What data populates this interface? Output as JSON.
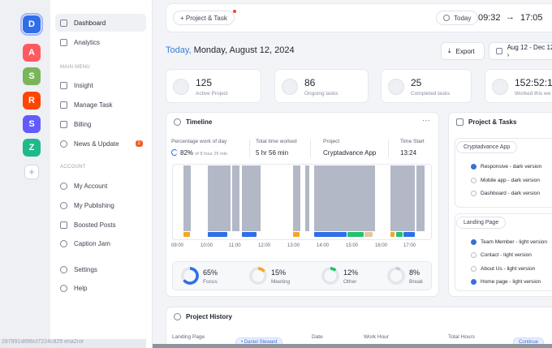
{
  "rail": {
    "apps": [
      {
        "icon": "app-logo-icon",
        "letter": "D",
        "color": "#2f6ee8"
      },
      {
        "icon": "airbnb-icon",
        "letter": "A",
        "color": "#ff5a5f"
      },
      {
        "icon": "shopify-icon",
        "letter": "S",
        "color": "#7ab55c"
      },
      {
        "icon": "reddit-icon",
        "letter": "R",
        "color": "#ff4500"
      },
      {
        "icon": "stripe-icon",
        "letter": "S",
        "color": "#635bff"
      },
      {
        "icon": "app-icon",
        "letter": "Z",
        "color": "#1fb98a"
      }
    ],
    "add_label": "+"
  },
  "sidebar": {
    "primary": [
      {
        "label": "Dashboard",
        "icon": "grid-icon",
        "active": true
      },
      {
        "label": "Analytics",
        "icon": "chart-icon"
      }
    ],
    "main_menu_title": "MAIN MENU",
    "main_menu": [
      {
        "label": "Insight",
        "icon": "trend-icon"
      },
      {
        "label": "Manage Task",
        "icon": "file-icon"
      },
      {
        "label": "Billing",
        "icon": "card-icon"
      },
      {
        "label": "News & Update",
        "icon": "clip-icon",
        "badge": "2"
      }
    ],
    "account_title": "ACCOUNT",
    "account": [
      {
        "label": "My Account",
        "icon": "user-icon"
      },
      {
        "label": "My Publishing",
        "icon": "users-icon"
      },
      {
        "label": "Boosted Posts",
        "icon": "megaphone-icon"
      },
      {
        "label": "Caption Jam",
        "icon": "history-icon"
      }
    ],
    "footer": [
      {
        "label": "Settings",
        "icon": "gear-icon"
      },
      {
        "label": "Help",
        "icon": "help-icon"
      }
    ]
  },
  "topbar": {
    "add_label": "+ Project & Task",
    "today_label": "Today",
    "time_start": "09:32",
    "arrow": "→",
    "time_end": "17:05"
  },
  "header": {
    "today": "Today,",
    "date": "Monday, August 12, 2024",
    "export_label": "Export",
    "range_label": "Aug 12 - Dec 12 ›"
  },
  "stats": [
    {
      "value": "125",
      "label": "Active Project"
    },
    {
      "value": "86",
      "label": "Ongoing tasks"
    },
    {
      "value": "25",
      "label": "Completed tasks"
    },
    {
      "value": "152:52:1",
      "label": "Worked this we"
    }
  ],
  "timeline": {
    "title": "Timeline",
    "more": "···",
    "metrics": {
      "work_label": "Percentage work of day",
      "work_value": "82%",
      "work_sub": "of 8 hour 25 min",
      "total_label": "Total time worked",
      "total_value": "5 hr 56 min",
      "project_label": "Project",
      "project_value": "Cryptadvance App",
      "start_label": "Time Start",
      "start_value": "13:24"
    },
    "ticks": [
      "09:00",
      "10:00",
      "11:00",
      "12:00",
      "13:00",
      "14:00",
      "15:00",
      "16:00",
      "17:00",
      "18:00"
    ],
    "summary": [
      {
        "pct": "65%",
        "label": "Focus",
        "color": "#2f6ee8",
        "value": 0.65
      },
      {
        "pct": "15%",
        "label": "Meeting",
        "color": "#f5a623",
        "value": 0.15
      },
      {
        "pct": "12%",
        "label": "Other",
        "color": "#21c26b",
        "value": 0.12
      },
      {
        "pct": "8%",
        "label": "Break",
        "color": "#c5c9d2",
        "value": 0.08
      }
    ]
  },
  "projects": {
    "title": "Project & Tasks",
    "groups": [
      {
        "name": "Cryptadvance App",
        "items": [
          {
            "label": "Responsive - dark version",
            "done": true
          },
          {
            "label": "Mobile app - dark version",
            "done": false
          },
          {
            "label": "Dashboard - dark version",
            "done": false
          }
        ]
      },
      {
        "name": "Landing Page",
        "items": [
          {
            "label": "Team Member - light version",
            "done": true
          },
          {
            "label": "Contact - light version",
            "done": false
          },
          {
            "label": "About Us - light version",
            "done": false
          },
          {
            "label": "Home page - light version",
            "done": true
          }
        ]
      }
    ]
  },
  "history": {
    "title": "Project History",
    "columns": [
      "Landing Page",
      "Date",
      "Work Hour",
      "Total Hours"
    ],
    "chip_left": "• Daniel Steward",
    "chip_right": "Continue"
  },
  "footer_hash": "287991df8f6cf7224c829 ena2ror"
}
